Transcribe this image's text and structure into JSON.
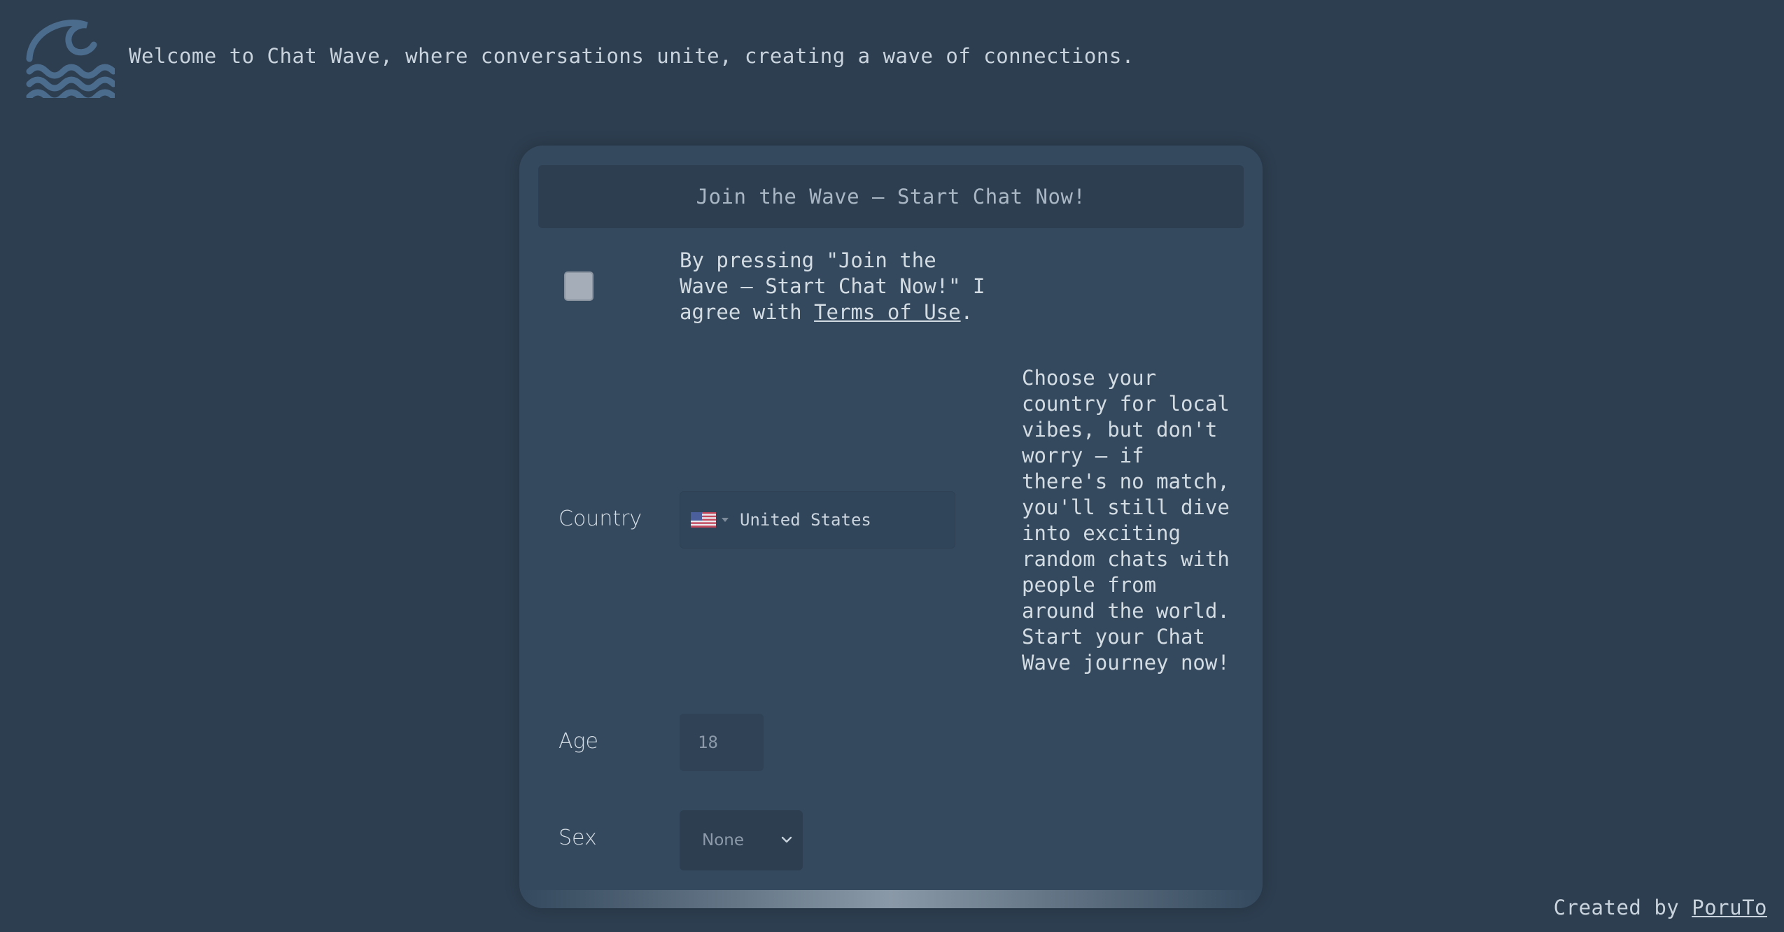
{
  "header": {
    "logo_icon": "wave-logo-icon",
    "welcome_text": "Welcome to Chat Wave, where conversations unite, creating a wave of connections."
  },
  "form": {
    "join_button_label": "Join the Wave – Start Chat Now!",
    "terms": {
      "checked": false,
      "text_before": "By pressing \"Join the Wave – Start Chat Now!\" I agree with ",
      "link_label": "Terms of Use",
      "text_after": "."
    },
    "country": {
      "label": "Country",
      "flag_icon": "us-flag-icon",
      "selected": "United States",
      "hint": "Choose your country for local vibes, but don't worry – if there's no match, you'll still dive into exciting random chats with people from around the world. Start your Chat Wave journey now!"
    },
    "age": {
      "label": "Age",
      "value": "18"
    },
    "sex": {
      "label": "Sex",
      "selected": "None"
    }
  },
  "footer": {
    "created_by_text": "Created by ",
    "author_link": "PoruTo"
  },
  "colors": {
    "background": "#2d3e50",
    "card": "#34495e",
    "button": "#2c3e50",
    "logo": "#4a6a8c"
  }
}
